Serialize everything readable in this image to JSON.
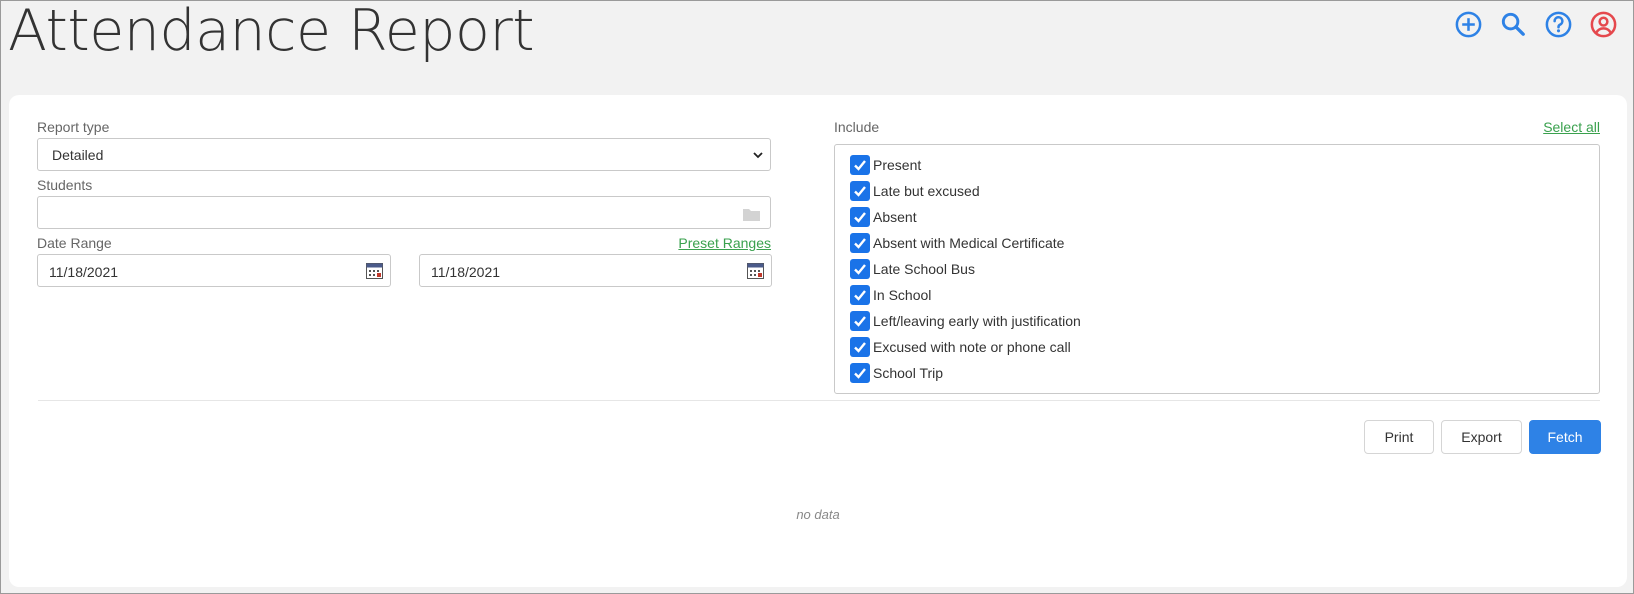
{
  "page": {
    "title": "Attendance Report"
  },
  "header_icons": [
    "add-circle-icon",
    "search-icon",
    "help-circle-icon",
    "user-account-icon"
  ],
  "colors": {
    "accent": "#2e82e6",
    "link": "#3aa14e",
    "danger": "#e5484d",
    "checkbox": "#1a73e8"
  },
  "form": {
    "report_type": {
      "label": "Report type",
      "value": "Detailed"
    },
    "students": {
      "label": "Students",
      "value": ""
    },
    "date_range": {
      "label": "Date Range",
      "preset_link": "Preset Ranges",
      "start": "11/18/2021",
      "end": "11/18/2021"
    }
  },
  "include": {
    "label": "Include",
    "select_all": "Select all",
    "options": [
      {
        "label": "Present",
        "checked": true
      },
      {
        "label": "Late but excused",
        "checked": true
      },
      {
        "label": "Absent",
        "checked": true
      },
      {
        "label": "Absent with Medical Certificate",
        "checked": true
      },
      {
        "label": "Late School Bus",
        "checked": true
      },
      {
        "label": "In School",
        "checked": true
      },
      {
        "label": "Left/leaving early with justification",
        "checked": true
      },
      {
        "label": "Excused with note or phone call",
        "checked": true
      },
      {
        "label": "School Trip",
        "checked": true
      }
    ]
  },
  "actions": {
    "print": "Print",
    "export": "Export",
    "fetch": "Fetch"
  },
  "results": {
    "empty_text": "no data"
  }
}
